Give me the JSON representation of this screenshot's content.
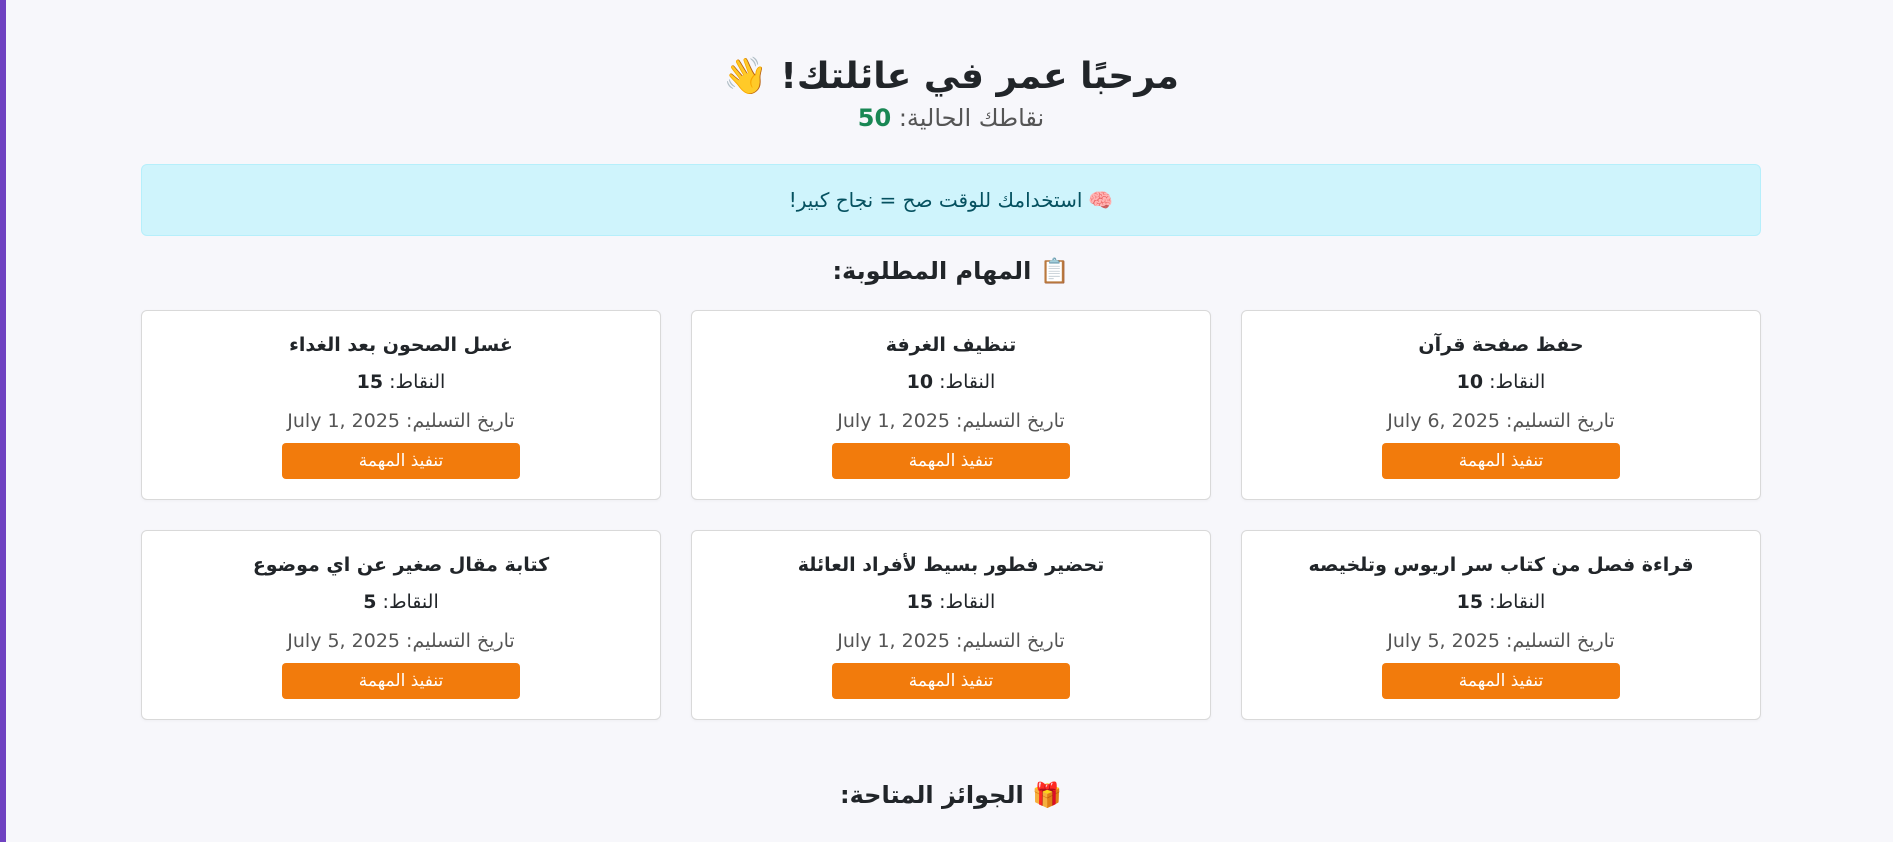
{
  "header": {
    "welcome_text": "مرحبًا عمر في عائلتك!",
    "welcome_emoji": "👋",
    "points_label": "نقاطك الحالية:",
    "points_value": "50"
  },
  "tip": {
    "emoji": "🧠",
    "text": "استخدامك للوقت صح = نجاح كبير!"
  },
  "tasks_section": {
    "emoji": "📋",
    "title": "المهام المطلوبة:",
    "points_label": "النقاط:",
    "due_label": "تاريخ التسليم:",
    "button_label": "تنفيذ المهمة",
    "items": [
      {
        "title": "حفظ صفحة قرآن",
        "points": "10",
        "due": "July 6, 2025"
      },
      {
        "title": "تنظيف الغرفة",
        "points": "10",
        "due": "July 1, 2025"
      },
      {
        "title": "غسل الصحون بعد الغداء",
        "points": "15",
        "due": "July 1, 2025"
      },
      {
        "title": "قراءة فصل من كتاب سر اريوس وتلخيصه",
        "points": "15",
        "due": "July 5, 2025"
      },
      {
        "title": "تحضير فطور بسيط لأفراد العائلة",
        "points": "15",
        "due": "July 1, 2025"
      },
      {
        "title": "كتابة مقال صغير عن اي موضوع",
        "points": "5",
        "due": "July 5, 2025"
      }
    ]
  },
  "rewards_section": {
    "emoji": "🎁",
    "title": "الجوائز المتاحة:"
  },
  "colors": {
    "accent": "#6f42c1",
    "points_green": "#198754",
    "button_orange": "#f27b0c",
    "tip_bg": "#cff4fc"
  }
}
